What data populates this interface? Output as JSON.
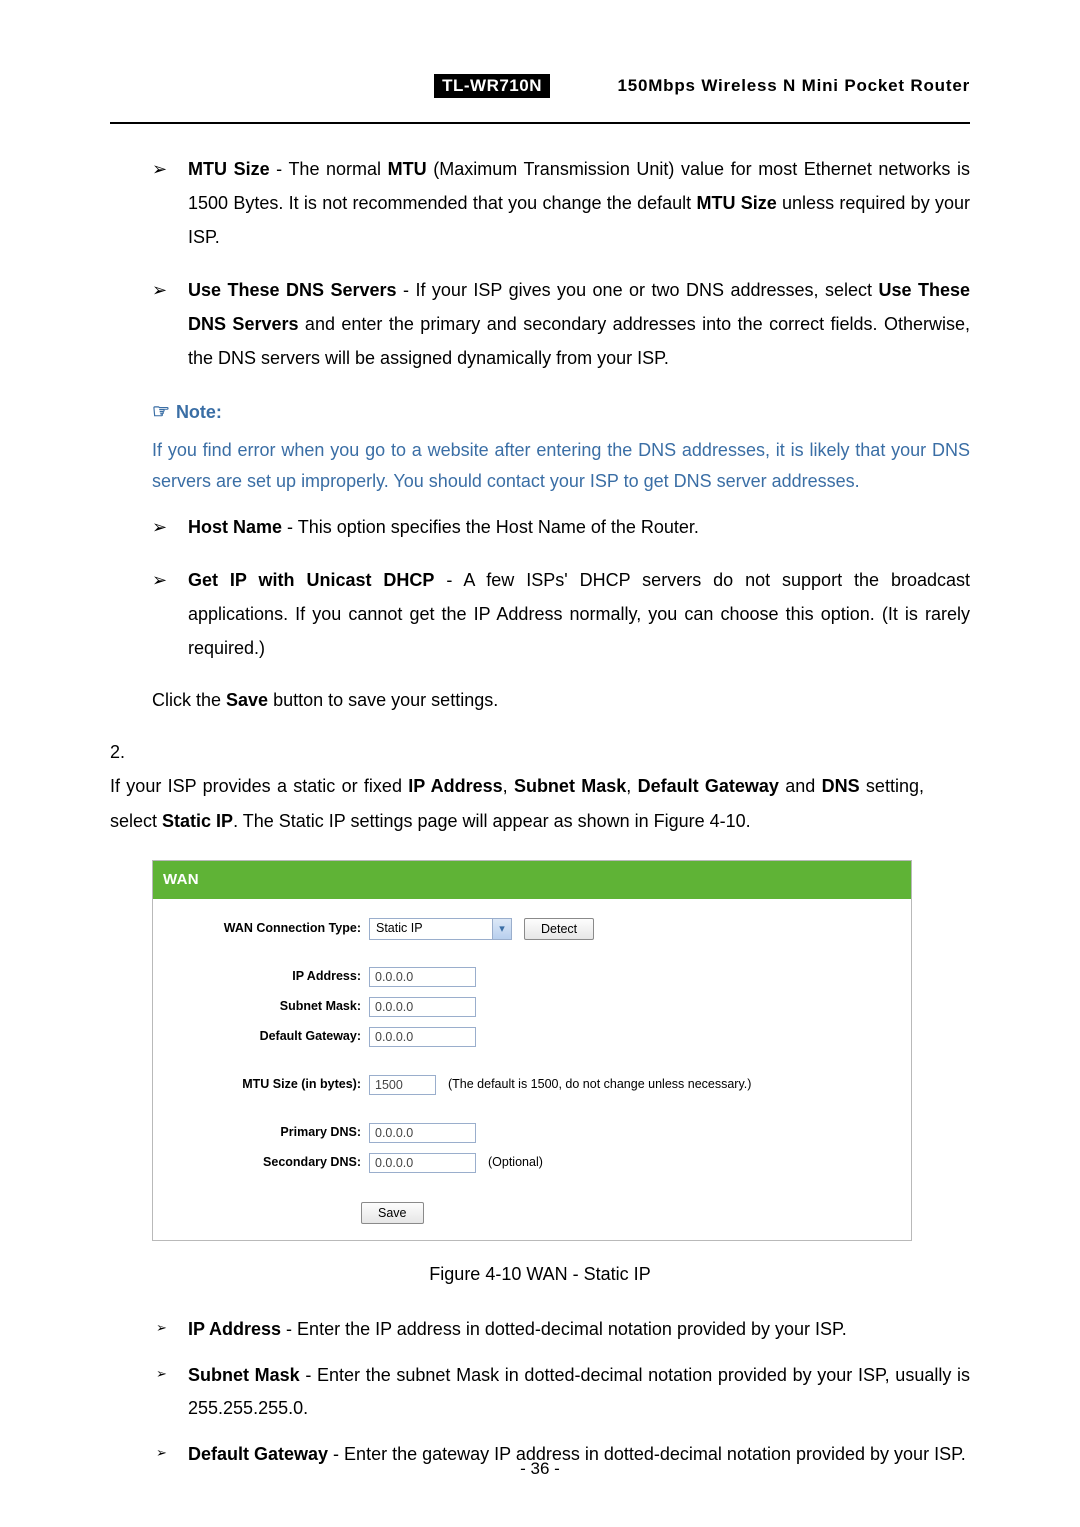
{
  "header": {
    "model": "TL-WR710N",
    "subtitle": "150Mbps Wireless N Mini Pocket Router"
  },
  "bullets_top": [
    {
      "bold": "MTU Size",
      "sep": " - ",
      "text_1": "The normal ",
      "bold2": "MTU",
      "text_2": " (Maximum Transmission Unit) value for most Ethernet networks is 1500 Bytes. It is not recommended that you change the default ",
      "bold3": "MTU Size",
      "text_3": " unless required by your ISP."
    },
    {
      "bold": "Use These DNS Servers",
      "sep": " - ",
      "text_1": "If your ISP gives you one or two DNS addresses, select ",
      "bold2": "Use These DNS Servers",
      "text_2": " and enter the primary and secondary addresses into the correct fields. Otherwise, the DNS servers will be assigned dynamically from your ISP."
    }
  ],
  "note": {
    "label": "Note:",
    "text": "If you find error when you go to a website after entering the DNS addresses, it is likely that your DNS servers are set up improperly. You should contact your ISP to get DNS server addresses."
  },
  "bullets_mid": [
    {
      "bold": "Host Name",
      "sep": " - ",
      "text": "This option specifies the Host Name of the Router."
    },
    {
      "bold": "Get IP with Unicast DHCP",
      "sep": " - ",
      "text": "A few ISPs' DHCP servers do not support the broadcast applications. If you cannot get the IP Address normally, you can choose this option. (It is rarely required.)"
    }
  ],
  "save_line": {
    "pre": "Click the ",
    "bold": "Save",
    "post": " button to save your settings."
  },
  "numbered": {
    "num": "2.",
    "pre": "If your ISP provides a static or fixed ",
    "b1": "IP Address",
    "c1": ", ",
    "b2": "Subnet Mask",
    "c2": ", ",
    "b3": "Default Gateway",
    "c3": " and ",
    "b4": "DNS",
    "mid": " setting, select ",
    "b5": "Static IP",
    "post": ". The Static IP settings page will appear as shown in Figure 4-10."
  },
  "wan": {
    "title": "WAN",
    "conn_label": "WAN Connection Type:",
    "conn_value": "Static IP",
    "detect": "Detect",
    "ip_label": "IP Address:",
    "ip_value": "0.0.0.0",
    "mask_label": "Subnet Mask:",
    "mask_value": "0.0.0.0",
    "gw_label": "Default Gateway:",
    "gw_value": "0.0.0.0",
    "mtu_label": "MTU Size (in bytes):",
    "mtu_value": "1500",
    "mtu_hint": "(The default is 1500, do not change unless necessary.)",
    "pdns_label": "Primary DNS:",
    "pdns_value": "0.0.0.0",
    "sdns_label": "Secondary DNS:",
    "sdns_value": "0.0.0.0",
    "sdns_hint": "(Optional)",
    "save": "Save"
  },
  "fig_caption": "Figure 4-10    WAN - Static IP",
  "bullets_bot": [
    {
      "bold": "IP Address",
      "sep": " - ",
      "text": "Enter the IP address in dotted-decimal notation provided by your ISP."
    },
    {
      "bold": "Subnet Mask",
      "sep": " - ",
      "text": "Enter the subnet Mask in dotted-decimal notation provided by your ISP, usually is 255.255.255.0."
    },
    {
      "bold": "Default Gateway",
      "sep": " - ",
      "text": "Enter the gateway IP address in dotted-decimal notation provided by your ISP."
    }
  ],
  "page_number": "- 36 -"
}
